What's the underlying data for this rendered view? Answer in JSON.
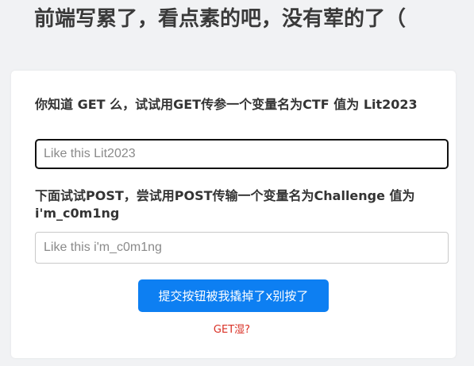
{
  "page": {
    "title": "前端写累了，看点素的吧，没有荤的了（"
  },
  "form": {
    "get_label": "你知道 GET 么，试试用GET传参一个变量名为CTF 值为 Lit2023",
    "get_placeholder": "Like this Lit2023",
    "get_value": "",
    "post_label": "下面试试POST，尝试用POST传输一个变量名为Challenge 值为 i'm_c0m1ng",
    "post_placeholder": "Like this i'm_c0m1ng",
    "post_value": "",
    "submit_label": "提交按钮被我撬掉了x别按了",
    "hint_link": "GET湿?"
  },
  "colors": {
    "button": "#0d7ff2",
    "hint": "#d93025",
    "focus_border": "#111111"
  }
}
